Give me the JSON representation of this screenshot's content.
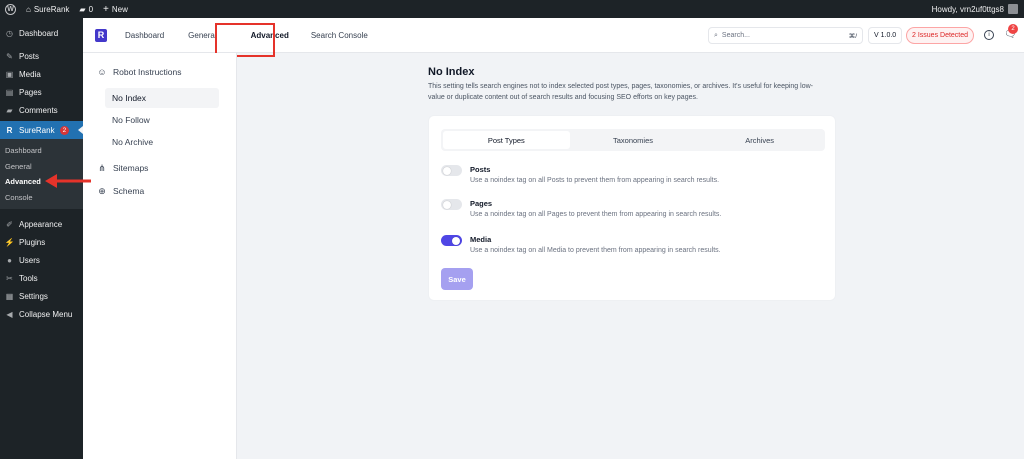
{
  "admin_bar": {
    "site_name": "SureRank",
    "comments_count": "0",
    "new_label": "New",
    "greeting": "Howdy, vrn2uf0ttgs8"
  },
  "wp_menu": {
    "items_top": [
      {
        "label": "Dashboard",
        "icon": "dashboard-icon"
      }
    ],
    "items_mid": [
      {
        "label": "Posts",
        "icon": "pin-icon"
      },
      {
        "label": "Media",
        "icon": "media-icon"
      },
      {
        "label": "Pages",
        "icon": "page-icon"
      },
      {
        "label": "Comments",
        "icon": "comment-icon"
      }
    ],
    "surerank": {
      "label": "SureRank",
      "badge": "2"
    },
    "submenu": [
      "Dashboard",
      "General",
      "Advanced",
      "Console"
    ],
    "items_bottom": [
      {
        "label": "Appearance",
        "icon": "brush-icon"
      },
      {
        "label": "Plugins",
        "icon": "plug-icon"
      },
      {
        "label": "Users",
        "icon": "user-icon"
      },
      {
        "label": "Tools",
        "icon": "wrench-icon"
      },
      {
        "label": "Settings",
        "icon": "settings-icon"
      },
      {
        "label": "Collapse Menu",
        "icon": "collapse-icon"
      }
    ]
  },
  "header": {
    "tabs": [
      "Dashboard",
      "General",
      "Advanced",
      "Search Console"
    ],
    "search_placeholder": "Search...",
    "search_shortcut": "⌘/",
    "version": "V 1.0.0",
    "issues": "2 Issues Detected",
    "notification_count": "2"
  },
  "settings_nav": {
    "robot": "Robot Instructions",
    "robot_items": [
      "No Index",
      "No Follow",
      "No Archive"
    ],
    "sitemaps": "Sitemaps",
    "schema": "Schema"
  },
  "content": {
    "title": "No Index",
    "description": "This setting tells search engines not to index selected post types, pages, taxonomies, or archives. It's useful for keeping low-value or duplicate content out of search results and focusing SEO efforts on key pages.",
    "tabs": [
      "Post Types",
      "Taxonomies",
      "Archives"
    ],
    "options": [
      {
        "label": "Posts",
        "help": "Use a noindex tag on all Posts to prevent them from appearing in search results.",
        "enabled": false
      },
      {
        "label": "Pages",
        "help": "Use a noindex tag on all Pages to prevent them from appearing in search results.",
        "enabled": false
      },
      {
        "label": "Media",
        "help": "Use a noindex tag on all Media to prevent them from appearing in search results.",
        "enabled": true
      }
    ],
    "save_label": "Save"
  },
  "colors": {
    "accent": "#4f46e5",
    "wp_active": "#2271b1",
    "highlight": "#e5332a"
  }
}
